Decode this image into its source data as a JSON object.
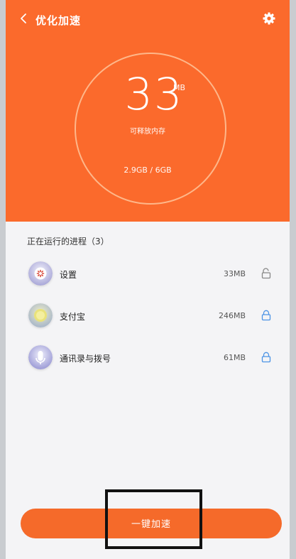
{
  "header": {
    "title": "优化加速",
    "back_icon": "chevron-left-icon",
    "settings_icon": "gear-icon"
  },
  "memory": {
    "releasable_value": "33",
    "releasable_unit": "MB",
    "releasable_caption": "可释放内存",
    "usage_text": "2.9GB / 6GB"
  },
  "process_section": {
    "title": "正在运行的进程（3）"
  },
  "processes": [
    {
      "name": "设置",
      "size": "33MB",
      "icon": "settings-app-icon",
      "locked": false
    },
    {
      "name": "支付宝",
      "size": "246MB",
      "icon": "alipay-app-icon",
      "locked": true
    },
    {
      "name": "通讯录与拨号",
      "size": "61MB",
      "icon": "contacts-app-icon",
      "locked": true
    }
  ],
  "action": {
    "label": "一键加速"
  },
  "colors": {
    "primary": "#fb6a2c",
    "lock_locked": "#4b93e5",
    "lock_unlocked": "#888888"
  }
}
